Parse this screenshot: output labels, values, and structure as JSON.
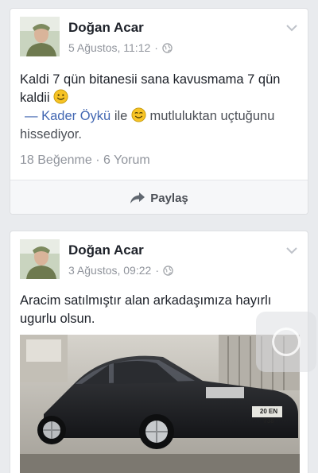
{
  "posts": [
    {
      "author": "Doğan Acar",
      "date": "5 Ağustos, 11:12",
      "separator": "·",
      "text_line": "Kaldi 7 qün bitanesii sana kavusmama 7 qün kaldii",
      "tag_prefix": "—",
      "tagged": "Kader Öykü",
      "with": "ile",
      "feeling": "mutluluktan uçtuğunu hissediyor.",
      "likes": "18 Beğenme",
      "dot": "·",
      "comments": "6 Yorum",
      "share_label": "Paylaş",
      "icons": [
        "avatar",
        "globe-icon",
        "chevron-down-icon",
        "smile-emoji-icon",
        "share-arrow-icon"
      ]
    },
    {
      "author": "Doğan Acar",
      "date": "3 Ağustos, 09:22",
      "separator": "·",
      "text": "Aracim satılmıştır alan arkadaşımıza hayırlı ugurlu olsun.",
      "license_plate": "20 EN 738",
      "icons": [
        "avatar",
        "globe-icon",
        "chevron-down-icon"
      ]
    }
  ],
  "colors": {
    "link": "#4267b2",
    "muted": "#90949c",
    "background": "#e9ebee",
    "emoji": "#f7c325"
  }
}
